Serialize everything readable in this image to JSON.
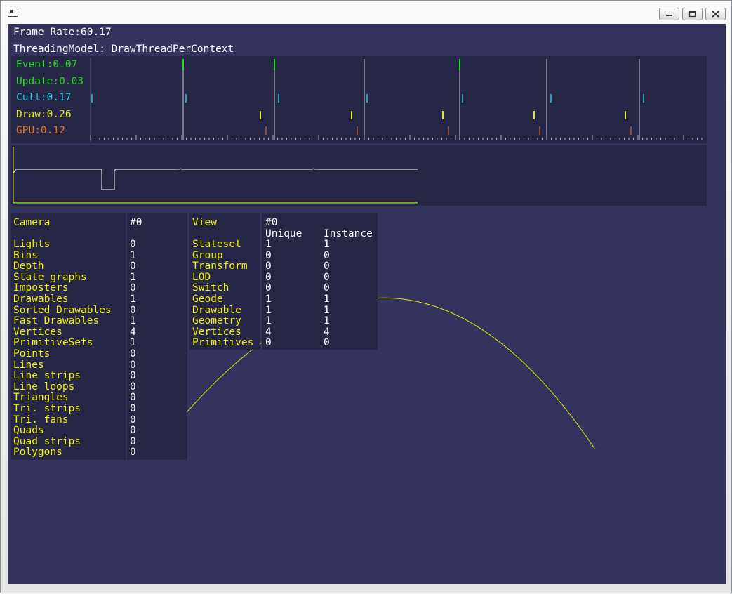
{
  "window": {
    "title": "",
    "buttons": {
      "minimize": "minimize",
      "maximize": "maximize",
      "close": "close"
    }
  },
  "stats": {
    "frame_rate": "Frame Rate:60.17",
    "threading_model": "ThreadingModel: DrawThreadPerContext",
    "timings": [
      {
        "label": "Event:0.07",
        "color": "#22dd22"
      },
      {
        "label": "Update:0.03",
        "color": "#22dd22"
      },
      {
        "label": "Cull:0.17",
        "color": "#22c8e6"
      },
      {
        "label": "Draw:0.26",
        "color": "#e6e622"
      },
      {
        "label": "GPU:0.12",
        "color": "#e67822"
      }
    ]
  },
  "camera_table": {
    "header_label": "Camera",
    "header_value": "#0",
    "rows": [
      {
        "label": "Lights",
        "value": "0"
      },
      {
        "label": "Bins",
        "value": "1"
      },
      {
        "label": "Depth",
        "value": "0"
      },
      {
        "label": "State graphs",
        "value": "1"
      },
      {
        "label": "Imposters",
        "value": "0"
      },
      {
        "label": "Drawables",
        "value": "1"
      },
      {
        "label": "Sorted Drawables",
        "value": "0"
      },
      {
        "label": "Fast Drawables",
        "value": "1"
      },
      {
        "label": "Vertices",
        "value": "4"
      },
      {
        "label": "PrimitiveSets",
        "value": "1"
      },
      {
        "label": "Points",
        "value": "0"
      },
      {
        "label": "Lines",
        "value": "0"
      },
      {
        "label": "Line strips",
        "value": "0"
      },
      {
        "label": "Line loops",
        "value": "0"
      },
      {
        "label": "Triangles",
        "value": "0"
      },
      {
        "label": "Tri. strips",
        "value": "0"
      },
      {
        "label": "Tri. fans",
        "value": "0"
      },
      {
        "label": "Quads",
        "value": "0"
      },
      {
        "label": "Quad strips",
        "value": "0"
      },
      {
        "label": "Polygons",
        "value": "0"
      }
    ]
  },
  "view_table": {
    "header_label": "View",
    "header_value": "#0",
    "col_unique": "Unique",
    "col_instance": "Instance",
    "rows": [
      {
        "label": "Stateset",
        "unique": "1",
        "instance": "1"
      },
      {
        "label": "Group",
        "unique": "0",
        "instance": "0"
      },
      {
        "label": "Transform",
        "unique": "0",
        "instance": "0"
      },
      {
        "label": "LOD",
        "unique": "0",
        "instance": "0"
      },
      {
        "label": "Switch",
        "unique": "0",
        "instance": "0"
      },
      {
        "label": "Geode",
        "unique": "1",
        "instance": "1"
      },
      {
        "label": "Drawable",
        "unique": "1",
        "instance": "1"
      },
      {
        "label": "Geometry",
        "unique": "1",
        "instance": "1"
      },
      {
        "label": "Vertices",
        "unique": "4",
        "instance": "4"
      },
      {
        "label": "Primitives",
        "unique": "0",
        "instance": "0"
      }
    ]
  },
  "scene": {
    "curve_color": "#e6e600",
    "background_color": "#33335e"
  }
}
